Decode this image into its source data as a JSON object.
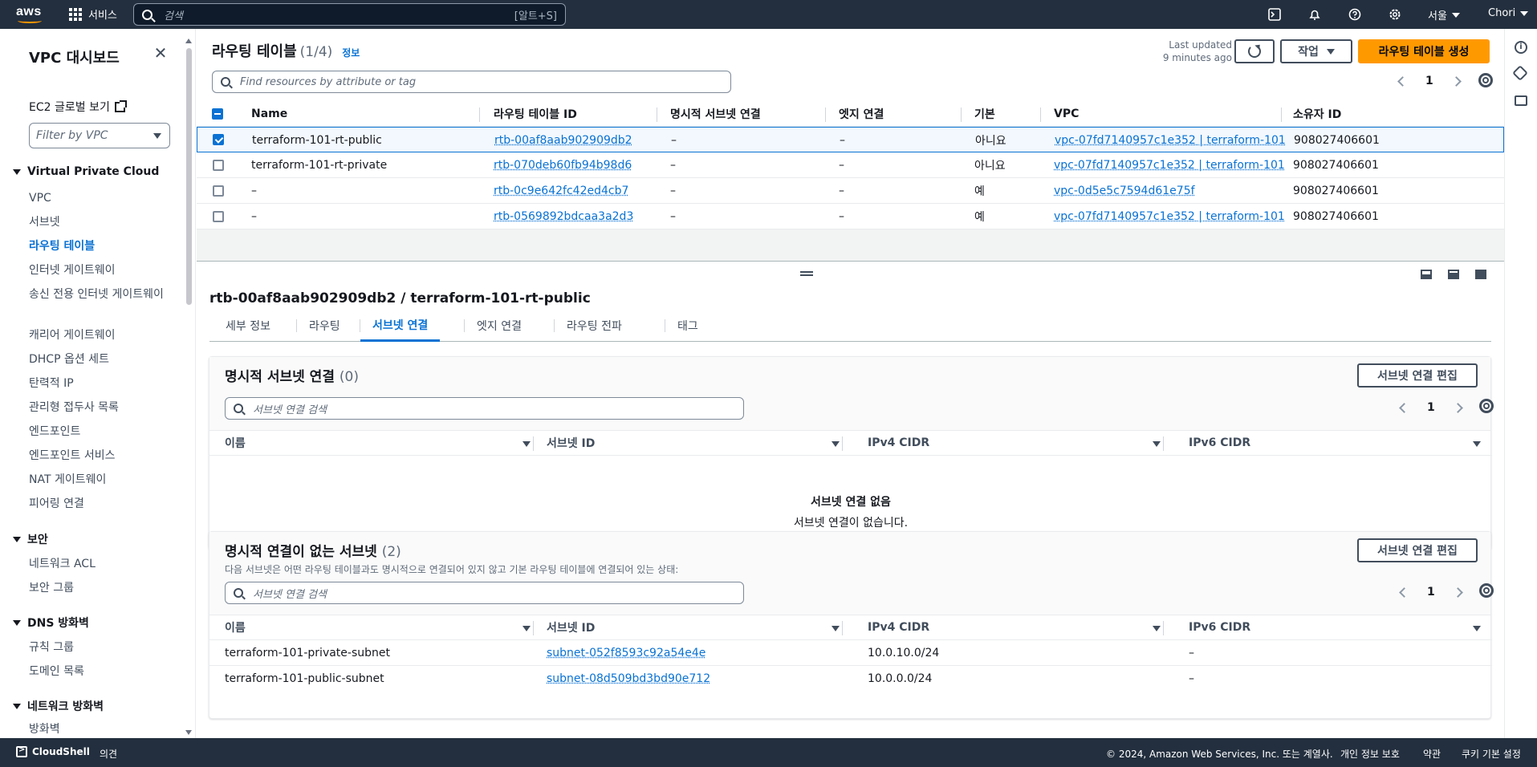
{
  "topnav": {
    "logo_text": "aws",
    "services_label": "서비스",
    "search_placeholder": "검색",
    "search_shortcut": "[알트+S]",
    "region_label": "서울",
    "user_label": "Chori"
  },
  "sidebar": {
    "title": "VPC 대시보드",
    "ec2_link": "EC2 글로벌 보기",
    "filter_placeholder": "Filter by VPC",
    "sections": [
      {
        "title": "Virtual Private Cloud",
        "items": [
          "VPC",
          "서브넷",
          "라우팅 테이블",
          "인터넷 게이트웨이",
          "송신 전용 인터넷 게이트웨이",
          "캐리어 게이트웨이",
          "DHCP 옵션 세트",
          "탄력적 IP",
          "관리형 접두사 목록",
          "엔드포인트",
          "엔드포인트 서비스",
          "NAT 게이트웨이",
          "피어링 연결"
        ]
      },
      {
        "title": "보안",
        "items": [
          "네트워크 ACL",
          "보안 그룹"
        ]
      },
      {
        "title": "DNS 방화벽",
        "items": [
          "규칙 그룹",
          "도메인 목록"
        ]
      },
      {
        "title": "네트워크 방화벽",
        "items": [
          "방화벽"
        ]
      }
    ],
    "active_item": "라우팅 테이블"
  },
  "route_tables": {
    "title": "라우팅 테이블",
    "count": "(1/4)",
    "info_link": "정보",
    "last_updated_label": "Last updated",
    "last_updated_value": "9 minutes ago",
    "actions_label": "작업",
    "create_label": "라우팅 테이블 생성",
    "search_placeholder": "Find resources by attribute or tag",
    "page": "1",
    "columns": [
      "Name",
      "라우팅 테이블 ID",
      "명시적 서브넷 연결",
      "엣지 연결",
      "기본",
      "VPC",
      "소유자 ID"
    ],
    "rows": [
      {
        "name": "terraform-101-rt-public",
        "id": "rtb-00af8aab902909db2",
        "explicit": "–",
        "edge": "–",
        "main": "아니요",
        "vpc": "vpc-07fd7140957c1e352 | terraform-101",
        "owner": "908027406601",
        "selected": true
      },
      {
        "name": "terraform-101-rt-private",
        "id": "rtb-070deb60fb94b98d6",
        "explicit": "–",
        "edge": "–",
        "main": "아니요",
        "vpc": "vpc-07fd7140957c1e352 | terraform-101",
        "owner": "908027406601",
        "selected": false
      },
      {
        "name": "–",
        "id": "rtb-0c9e642fc42ed4cb7",
        "explicit": "–",
        "edge": "–",
        "main": "예",
        "vpc": "vpc-0d5e5c7594d61e75f",
        "owner": "908027406601",
        "selected": false
      },
      {
        "name": "–",
        "id": "rtb-0569892bdcaa3a2d3",
        "explicit": "–",
        "edge": "–",
        "main": "예",
        "vpc": "vpc-07fd7140957c1e352 | terraform-101",
        "owner": "908027406601",
        "selected": false
      }
    ]
  },
  "detail": {
    "title": "rtb-00af8aab902909db2 / terraform-101-rt-public",
    "tabs": [
      "세부 정보",
      "라우팅",
      "서브넷 연결",
      "엣지 연결",
      "라우팅 전파",
      "태그"
    ],
    "active_tab": "서브넷 연결",
    "explicit": {
      "title": "명시적 서브넷 연결",
      "count": "(0)",
      "edit_label": "서브넷 연결 편집",
      "search_placeholder": "서브넷 연결 검색",
      "page": "1",
      "columns": [
        "이름",
        "서브넷 ID",
        "IPv4 CIDR",
        "IPv6 CIDR"
      ],
      "empty_title": "서브넷 연결 없음",
      "empty_desc": "서브넷 연결이 없습니다."
    },
    "implicit": {
      "title": "명시적 연결이 없는 서브넷",
      "count": "(2)",
      "description": "다음 서브넷은 어떤 라우팅 테이블과도 명시적으로 연결되어 있지 않고 기본 라우팅 테이블에 연결되어 있는 상태:",
      "edit_label": "서브넷 연결 편집",
      "search_placeholder": "서브넷 연결 검색",
      "page": "1",
      "columns": [
        "이름",
        "서브넷 ID",
        "IPv4 CIDR",
        "IPv6 CIDR"
      ],
      "rows": [
        {
          "name": "terraform-101-private-subnet",
          "subnet": "subnet-052f8593c92a54e4e",
          "ipv4": "10.0.10.0/24",
          "ipv6": "–"
        },
        {
          "name": "terraform-101-public-subnet",
          "subnet": "subnet-08d509bd3bd90e712",
          "ipv4": "10.0.0.0/24",
          "ipv6": "–"
        }
      ]
    }
  },
  "footer": {
    "cloudshell": "CloudShell",
    "feedback": "의견",
    "copyright": "© 2024, Amazon Web Services, Inc. 또는 계열사.",
    "privacy": "개인 정보 보호",
    "terms": "약관",
    "cookies": "쿠키 기본 설정"
  }
}
